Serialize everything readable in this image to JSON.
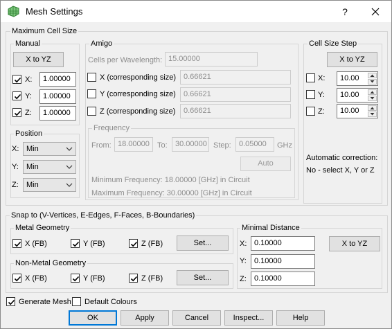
{
  "window": {
    "title": "Mesh Settings",
    "help_glyph": "?"
  },
  "max_cell": {
    "label": "Maximum Cell Size",
    "manual": {
      "label": "Manual",
      "x_to_yz": "X to YZ",
      "rows": [
        {
          "label": "X:",
          "value": "1.00000",
          "checked": true
        },
        {
          "label": "Y:",
          "value": "1.00000",
          "checked": true
        },
        {
          "label": "Z:",
          "value": "1.00000",
          "checked": true
        }
      ]
    },
    "position": {
      "label": "Position",
      "rows": [
        {
          "label": "X:",
          "value": "Min"
        },
        {
          "label": "Y:",
          "value": "Min"
        },
        {
          "label": "Z:",
          "value": "Min"
        }
      ]
    },
    "amigo": {
      "label": "Amigo",
      "cpw_label": "Cells per Wavelength:",
      "cpw_value": "15.00000",
      "rows": [
        {
          "label": "X (corresponding size)",
          "value": "0.66621",
          "checked": false
        },
        {
          "label": "Y (corresponding size)",
          "value": "0.66621",
          "checked": false
        },
        {
          "label": "Z (corresponding size)",
          "value": "0.66621",
          "checked": false
        }
      ],
      "frequency": {
        "label": "Frequency",
        "from_label": "From:",
        "from_value": "18.00000",
        "to_label": "To:",
        "to_value": "30.00000",
        "step_label": "Step:",
        "step_value": "0.05000",
        "unit": "GHz",
        "auto": "Auto",
        "min_text": "Minimum Frequency: 18.00000 [GHz] in Circuit",
        "max_text": "Maximum Frequency: 30.00000 [GHz] in Circuit"
      }
    },
    "step": {
      "label": "Cell Size Step",
      "x_to_yz": "X to YZ",
      "rows": [
        {
          "label": "X:",
          "value": "10.00",
          "checked": false
        },
        {
          "label": "Y:",
          "value": "10.00",
          "checked": false
        },
        {
          "label": "Z:",
          "value": "10.00",
          "checked": false
        }
      ],
      "auto_correction_title": "Automatic correction:",
      "auto_correction_text": "No - select X, Y or Z"
    }
  },
  "snap": {
    "label": "Snap to (V-Vertices, E-Edges, F-Faces, B-Boundaries)",
    "metal": {
      "label": "Metal Geometry",
      "x": "X (FB)",
      "y": "Y (FB)",
      "z": "Z (FB)",
      "x_checked": true,
      "y_checked": true,
      "z_checked": true,
      "set": "Set..."
    },
    "nonmetal": {
      "label": "Non-Metal Geometry",
      "x": "X (FB)",
      "y": "Y (FB)",
      "z": "Z (FB)",
      "x_checked": true,
      "y_checked": true,
      "z_checked": true,
      "set": "Set..."
    },
    "min_dist": {
      "label": "Minimal Distance",
      "x_label": "X:",
      "x_value": "0.10000",
      "y_label": "Y:",
      "y_value": "0.10000",
      "z_label": "Z:",
      "z_value": "0.10000",
      "x_to_yz": "X to YZ"
    }
  },
  "footer": {
    "generate_mesh": "Generate Mesh",
    "generate_mesh_checked": true,
    "default_colours": "Default Colours",
    "default_colours_checked": false,
    "ok": "OK",
    "apply": "Apply",
    "cancel": "Cancel",
    "inspect": "Inspect...",
    "help": "Help"
  }
}
